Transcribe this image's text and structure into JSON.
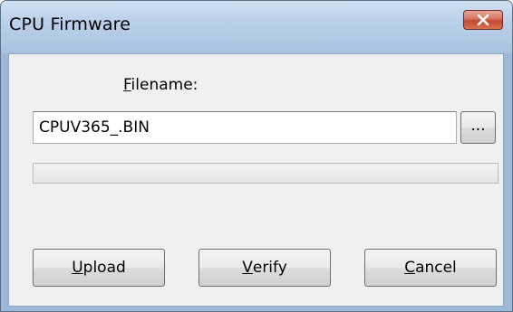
{
  "window": {
    "title": "CPU Firmware",
    "close_icon": "close-x-icon"
  },
  "filename": {
    "label_accel": "F",
    "label_rest": "ilename:",
    "value": "CPUV365_.BIN",
    "browse_label": "..."
  },
  "progress": {
    "fraction": 0
  },
  "buttons": {
    "upload": {
      "accel": "U",
      "rest": "pload"
    },
    "verify": {
      "accel": "V",
      "rest": "erify"
    },
    "cancel": {
      "accel": "C",
      "rest": "ancel"
    }
  }
}
